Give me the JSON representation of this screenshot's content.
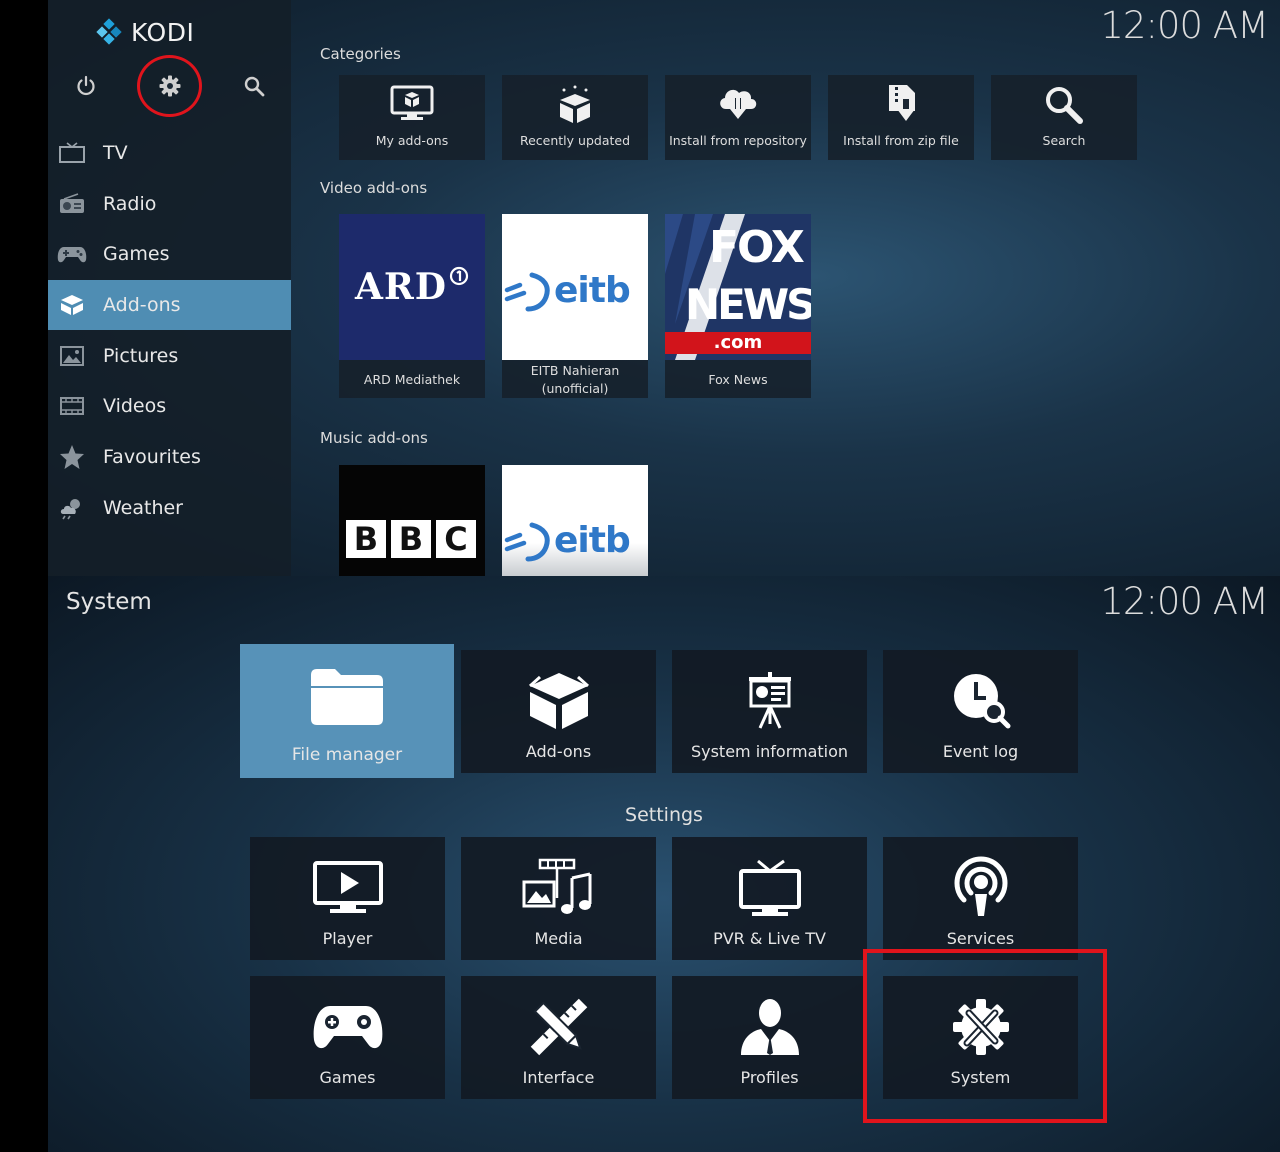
{
  "app": {
    "name": "KODI"
  },
  "clock": {
    "time": "12:00 AM"
  },
  "top_icons": [
    "power-icon",
    "gear-icon",
    "search-icon"
  ],
  "sidebar": {
    "items": [
      {
        "label": "TV",
        "icon": "tv-icon"
      },
      {
        "label": "Radio",
        "icon": "radio-icon"
      },
      {
        "label": "Games",
        "icon": "gamepad-icon"
      },
      {
        "label": "Add-ons",
        "icon": "addons-box-icon",
        "active": true
      },
      {
        "label": "Pictures",
        "icon": "picture-icon"
      },
      {
        "label": "Videos",
        "icon": "film-icon"
      },
      {
        "label": "Favourites",
        "icon": "star-icon"
      },
      {
        "label": "Weather",
        "icon": "weather-icon"
      }
    ]
  },
  "addons": {
    "categories_label": "Categories",
    "categories": [
      {
        "label": "My add-ons",
        "icon": "monitor-box-icon"
      },
      {
        "label": "Recently updated",
        "icon": "box-sparkle-icon"
      },
      {
        "label": "Install from repository",
        "icon": "cloud-download-icon"
      },
      {
        "label": "Install from zip file",
        "icon": "zip-download-icon"
      },
      {
        "label": "Search",
        "icon": "search-icon"
      }
    ],
    "video_label": "Video add-ons",
    "video": [
      {
        "label": "ARD Mediathek",
        "logo_text": "ARD"
      },
      {
        "label": "EITB Nahieran (unofficial)",
        "logo_text": "eitb"
      },
      {
        "label": "Fox News",
        "logo_text_1": "FOX",
        "logo_text_2": "NEWS",
        "logo_text_3": ".com"
      }
    ],
    "music_label": "Music add-ons",
    "music": [
      {
        "logo_letters": [
          "B",
          "B",
          "C"
        ]
      },
      {
        "logo_text": "eitb"
      }
    ]
  },
  "system": {
    "title": "System",
    "top_tiles": [
      {
        "label": "File manager",
        "icon": "folder-icon",
        "focused": true
      },
      {
        "label": "Add-ons",
        "icon": "addons-box-icon"
      },
      {
        "label": "System information",
        "icon": "presentation-board-icon"
      },
      {
        "label": "Event log",
        "icon": "clock-search-icon"
      }
    ],
    "settings_label": "Settings",
    "settings_row1": [
      {
        "label": "Player",
        "icon": "play-monitor-icon"
      },
      {
        "label": "Media",
        "icon": "media-icon"
      },
      {
        "label": "PVR & Live TV",
        "icon": "tv-antenna-icon"
      },
      {
        "label": "Services",
        "icon": "podcast-icon"
      }
    ],
    "settings_row2": [
      {
        "label": "Games",
        "icon": "gamepad-icon"
      },
      {
        "label": "Interface",
        "icon": "pencil-ruler-icon"
      },
      {
        "label": "Profiles",
        "icon": "user-icon"
      },
      {
        "label": "System",
        "icon": "gear-tools-icon"
      }
    ]
  },
  "colors": {
    "accent": "#4f8db3",
    "highlight": "#e0141c",
    "fox_red": "#d2141b",
    "ard_blue": "#1d2a6b",
    "eitb_blue": "#2f78c8"
  }
}
